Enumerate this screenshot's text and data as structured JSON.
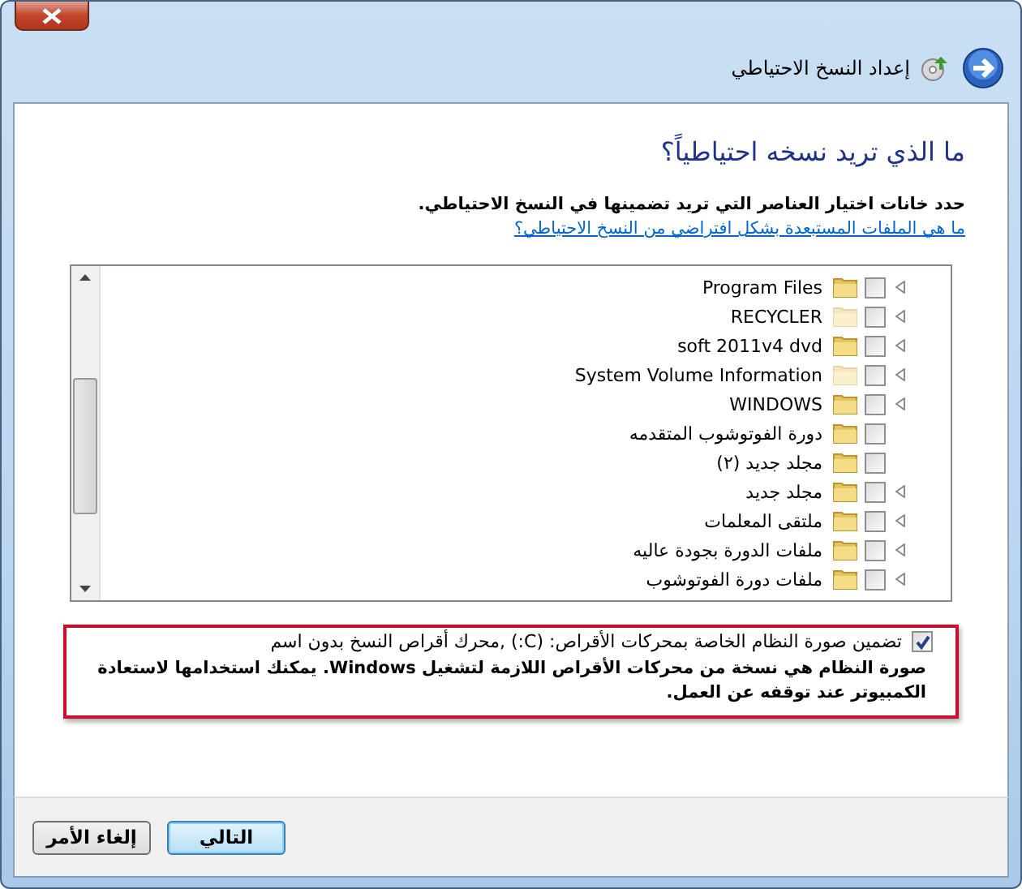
{
  "window": {
    "title": "إعداد النسخ الاحتياطي"
  },
  "heading": "ما الذي تريد نسخه احتياطياً؟",
  "instruction": {
    "text": "حدد خانات اختيار العناصر التي تريد تضمينها في النسخ الاحتياطي.",
    "link": "ما هي الملفات المستبعدة بشكل افتراضي من النسخ الاحتياطي؟"
  },
  "tree": {
    "items": [
      {
        "label": "Program Files",
        "checked": false,
        "expandable": true,
        "hidden": false
      },
      {
        "label": "RECYCLER",
        "checked": false,
        "expandable": true,
        "hidden": true
      },
      {
        "label": "soft 2011v4 dvd",
        "checked": false,
        "expandable": true,
        "hidden": false
      },
      {
        "label": "System Volume Information",
        "checked": false,
        "expandable": true,
        "hidden": true
      },
      {
        "label": "WINDOWS",
        "checked": false,
        "expandable": true,
        "hidden": false
      },
      {
        "label": "دورة الفوتوشوب المتقدمه",
        "checked": false,
        "expandable": false,
        "hidden": false
      },
      {
        "label": "مجلد جديد (٢)",
        "checked": false,
        "expandable": false,
        "hidden": false
      },
      {
        "label": "مجلد جديد",
        "checked": false,
        "expandable": true,
        "hidden": false
      },
      {
        "label": "ملتقى المعلمات",
        "checked": false,
        "expandable": true,
        "hidden": false
      },
      {
        "label": "ملفات الدورة بجودة عاليه",
        "checked": false,
        "expandable": true,
        "hidden": false
      },
      {
        "label": "ملفات دورة الفوتوشوب",
        "checked": false,
        "expandable": true,
        "hidden": false
      }
    ]
  },
  "system_image": {
    "label": "تضمين صورة النظام الخاصة بمحركات الأقراص: (C:) ,محرك أقراص النسخ بدون اسم",
    "checked": true,
    "description": "صورة النظام هي نسخة من محركات الأقراص اللازمة لتشغيل Windows. يمكنك استخدامها لاستعادة الكمبيوتر عند توقفه عن العمل."
  },
  "buttons": [
    {
      "label": "التالي",
      "kind": "primary"
    },
    {
      "label": "إلغاء الأمر",
      "kind": "normal"
    }
  ]
}
